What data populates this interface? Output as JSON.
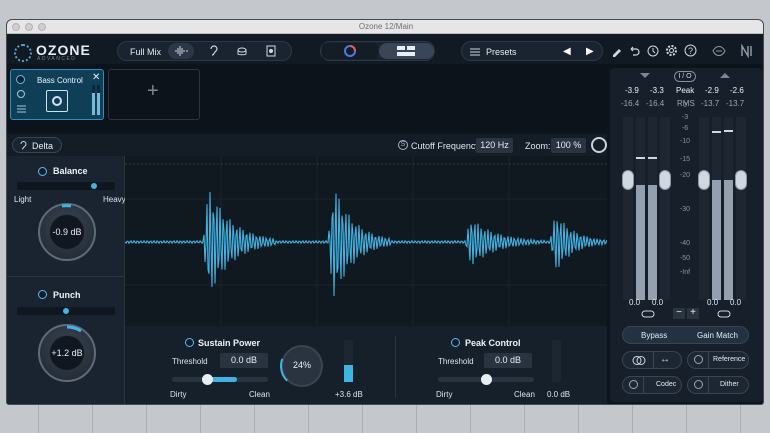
{
  "window": {
    "title": "Ozone 12/Main"
  },
  "logo": {
    "name": "OZONE",
    "sub": "ADVANCED"
  },
  "topbar": {
    "full_mix": "Full Mix",
    "presets": "Presets"
  },
  "module": {
    "name": "Bass Control",
    "add_icon": "+"
  },
  "delta": {
    "label": "Delta"
  },
  "cutoff": {
    "label": "Cutoff Frequency:",
    "value": "120 Hz"
  },
  "zoom": {
    "label": "Zoom:",
    "value": "100 %"
  },
  "balance": {
    "title": "Balance",
    "left": "Light",
    "right": "Heavy",
    "value": "-0.9 dB",
    "level": 0.8
  },
  "punch": {
    "title": "Punch",
    "value": "+1.2 dB",
    "level": 0.5
  },
  "sustain": {
    "title": "Sustain Power",
    "threshold_label": "Threshold",
    "threshold_value": "0.0 dB",
    "left": "Dirty",
    "right": "Clean",
    "amount": "24%",
    "amount_level": 0.24,
    "gain": "+3.6 dB",
    "gain_level": 0.4,
    "slider_level": 0.35
  },
  "peak": {
    "title": "Peak Control",
    "threshold_label": "Threshold",
    "threshold_value": "0.0 dB",
    "left": "Dirty",
    "right": "Clean",
    "gain": "0.0 dB",
    "gain_level": 0,
    "slider_level": 0.5
  },
  "meters": {
    "io_label": "I / O",
    "peak_label": "Peak",
    "rms_label": "RMS",
    "in_peak": [
      "-3.9",
      "-3.3"
    ],
    "in_rms": [
      "-16.4",
      "-16.4"
    ],
    "out_peak": [
      "-2.9",
      "-2.6"
    ],
    "out_rms": [
      "-13.7",
      "-13.7"
    ],
    "scale": [
      "0",
      "-3",
      "-6",
      "-10",
      "-15",
      "-20",
      "-30",
      "-40",
      "-50",
      "-Inf"
    ],
    "in_gain": [
      "0.0",
      "0.0"
    ],
    "out_gain": [
      "0.0",
      "0.0"
    ],
    "minus": "−",
    "plus": "+"
  },
  "buttons": {
    "bypass": "Bypass",
    "gain_match": "Gain Match",
    "reference": "Reference",
    "codec": "Codec",
    "dither": "Dither"
  },
  "colors": {
    "accent": "#3fb3e3",
    "bg": "#0e141c",
    "panel": "#16202b"
  }
}
